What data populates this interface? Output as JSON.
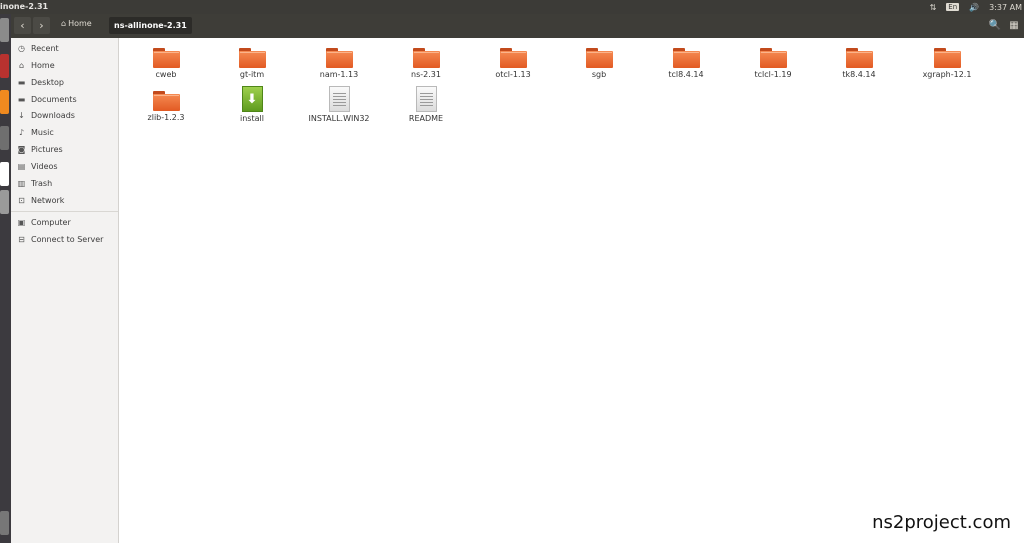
{
  "window": {
    "title": "inone-2.31"
  },
  "tray": {
    "keyboard": "En",
    "time": "3:37 AM"
  },
  "toolbar": {
    "back_icon": "chevron-left-icon",
    "forward_icon": "chevron-right-icon",
    "home_label": "Home",
    "current_label": "ns-allinone-2.31"
  },
  "sidebar": {
    "items": [
      {
        "label": "Recent",
        "icon": "clock-icon"
      },
      {
        "label": "Home",
        "icon": "home-icon"
      },
      {
        "label": "Desktop",
        "icon": "folder-icon"
      },
      {
        "label": "Documents",
        "icon": "folder-icon"
      },
      {
        "label": "Downloads",
        "icon": "download-icon"
      },
      {
        "label": "Music",
        "icon": "music-icon"
      },
      {
        "label": "Pictures",
        "icon": "camera-icon"
      },
      {
        "label": "Videos",
        "icon": "film-icon"
      },
      {
        "label": "Trash",
        "icon": "trash-icon"
      },
      {
        "label": "Network",
        "icon": "network-icon"
      },
      {
        "label": "Computer",
        "icon": "computer-icon"
      },
      {
        "label": "Connect to Server",
        "icon": "server-icon"
      }
    ]
  },
  "files": [
    {
      "name": "cweb",
      "type": "folder"
    },
    {
      "name": "gt-itm",
      "type": "folder"
    },
    {
      "name": "nam-1.13",
      "type": "folder"
    },
    {
      "name": "ns-2.31",
      "type": "folder"
    },
    {
      "name": "otcl-1.13",
      "type": "folder"
    },
    {
      "name": "sgb",
      "type": "folder"
    },
    {
      "name": "tcl8.4.14",
      "type": "folder"
    },
    {
      "name": "tclcl-1.19",
      "type": "folder"
    },
    {
      "name": "tk8.4.14",
      "type": "folder"
    },
    {
      "name": "xgraph-12.1",
      "type": "folder"
    },
    {
      "name": "zlib-1.2.3",
      "type": "folder"
    },
    {
      "name": "install",
      "type": "executable"
    },
    {
      "name": "INSTALL.WIN32",
      "type": "text"
    },
    {
      "name": "README",
      "type": "text"
    }
  ],
  "watermark": "ns2project.com"
}
